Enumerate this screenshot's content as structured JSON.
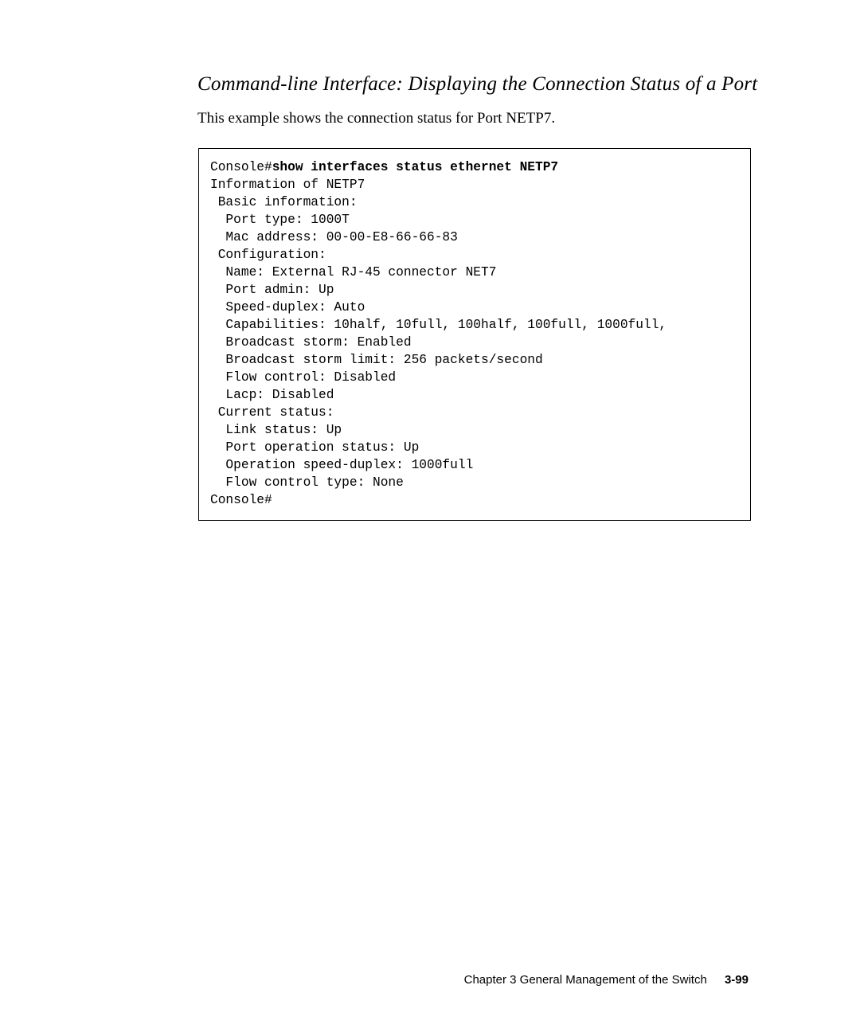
{
  "heading": "Command-line Interface: Displaying the Connection Status of a Port",
  "intro": "This example shows the connection status for Port NETP7.",
  "console": {
    "prompt1": "Console#",
    "command": "show interfaces status ethernet NETP7",
    "lines": {
      "l1": "Information of NETP7",
      "l2": " Basic information:",
      "l3": "  Port type: 1000T",
      "l4": "  Mac address: 00-00-E8-66-66-83",
      "l5": " Configuration:",
      "l6": "  Name: External RJ-45 connector NET7",
      "l7": "  Port admin: Up",
      "l8": "  Speed-duplex: Auto",
      "l9": "  Capabilities: 10half, 10full, 100half, 100full, 1000full,",
      "l10": "  Broadcast storm: Enabled",
      "l11": "  Broadcast storm limit: 256 packets/second",
      "l12": "  Flow control: Disabled",
      "l13": "  Lacp: Disabled",
      "l14": " Current status:",
      "l15": "  Link status: Up",
      "l16": "  Port operation status: Up",
      "l17": "  Operation speed-duplex: 1000full",
      "l18": "  Flow control type: None"
    },
    "prompt2": "Console#"
  },
  "footer": {
    "chapter": "Chapter 3   General Management of the Switch",
    "page": "3-99"
  }
}
